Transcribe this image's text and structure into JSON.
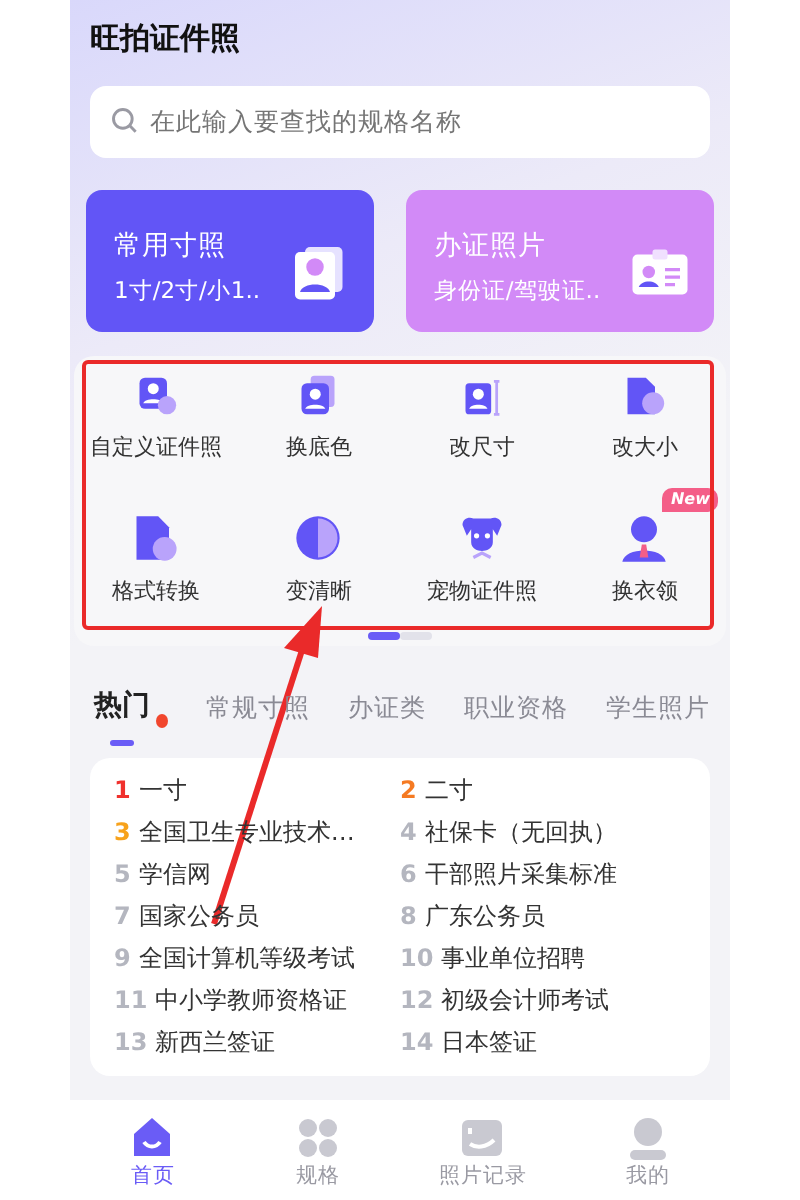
{
  "app_title": "旺拍证件照",
  "search": {
    "placeholder": "在此输入要查找的规格名称"
  },
  "feature_cards": [
    {
      "title": "常用寸照",
      "subtitle": "1寸/2寸/小1..",
      "kind": "photos"
    },
    {
      "title": "办证照片",
      "subtitle": "身份证/驾驶证..",
      "kind": "idcard"
    }
  ],
  "tools": [
    {
      "label": "自定义证件照",
      "kind": "custom"
    },
    {
      "label": "换底色",
      "kind": "background"
    },
    {
      "label": "改尺寸",
      "kind": "resize"
    },
    {
      "label": "改大小",
      "kind": "filesize"
    },
    {
      "label": "格式转换",
      "kind": "format"
    },
    {
      "label": "变清晰",
      "kind": "sharpen"
    },
    {
      "label": "宠物证件照",
      "kind": "pet"
    },
    {
      "label": "换衣领",
      "kind": "clothes",
      "badge": "New"
    }
  ],
  "pager": [
    {
      "selected": true
    },
    {
      "selected": false
    }
  ],
  "category_tabs": [
    {
      "label": "热门",
      "selected": true,
      "hot": true
    },
    {
      "label": "常规寸照",
      "selected": false,
      "hot": false
    },
    {
      "label": "办证类",
      "selected": false,
      "hot": false
    },
    {
      "label": "职业资格",
      "selected": false,
      "hot": false
    },
    {
      "label": "学生照片",
      "selected": false,
      "hot": false
    }
  ],
  "hot_list": [
    {
      "rank": "1",
      "name": "一寸",
      "color": "#f0312d"
    },
    {
      "rank": "2",
      "name": "二寸",
      "color": "#f57a22"
    },
    {
      "rank": "3",
      "name": "全国卫生专业技术…",
      "color": "#f7a21b"
    },
    {
      "rank": "4",
      "name": "社保卡（无回执）",
      "color": "#b4b6bf"
    },
    {
      "rank": "5",
      "name": "学信网",
      "color": "#b4b6bf"
    },
    {
      "rank": "6",
      "name": "干部照片采集标准",
      "color": "#b4b6bf"
    },
    {
      "rank": "7",
      "name": "国家公务员",
      "color": "#b4b6bf"
    },
    {
      "rank": "8",
      "name": "广东公务员",
      "color": "#b4b6bf"
    },
    {
      "rank": "9",
      "name": "全国计算机等级考试",
      "color": "#b4b6bf"
    },
    {
      "rank": "10",
      "name": "事业单位招聘",
      "color": "#b4b6bf"
    },
    {
      "rank": "11",
      "name": "中小学教师资格证",
      "color": "#b4b6bf"
    },
    {
      "rank": "12",
      "name": "初级会计师考试",
      "color": "#b4b6bf"
    },
    {
      "rank": "13",
      "name": "新西兰签证",
      "color": "#b4b6bf"
    },
    {
      "rank": "14",
      "name": "日本签证",
      "color": "#b4b6bf"
    }
  ],
  "bottom_nav": [
    {
      "label": "首页",
      "kind": "home",
      "selected": true
    },
    {
      "label": "规格",
      "kind": "grid",
      "selected": false
    },
    {
      "label": "照片记录",
      "kind": "photo",
      "selected": false
    },
    {
      "label": "我的",
      "kind": "user",
      "selected": false
    }
  ],
  "annotation": {
    "kind": "box-and-arrow"
  }
}
